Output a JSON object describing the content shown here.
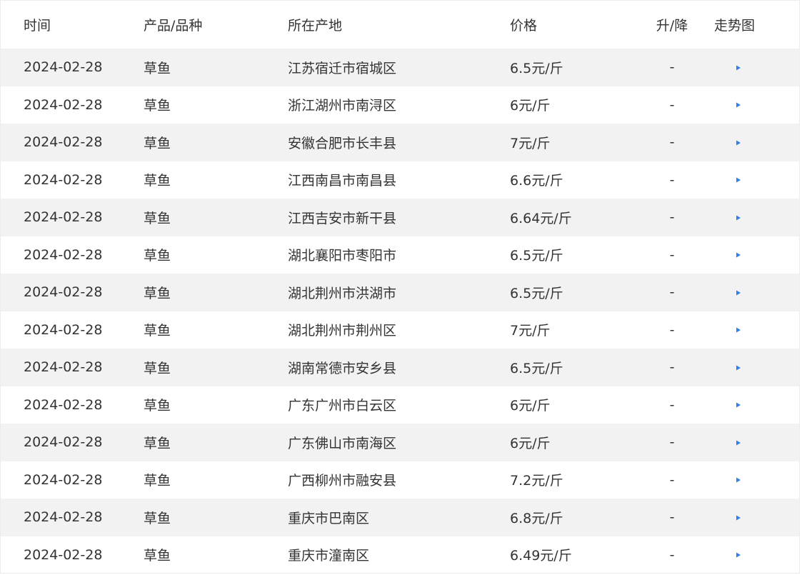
{
  "header": {
    "date": "时间",
    "product": "产品/品种",
    "place": "所在产地",
    "price": "价格",
    "change": "升/降",
    "trend": "走势图"
  },
  "rows": [
    {
      "date": "2024-02-28",
      "product": "草鱼",
      "place": "江苏宿迁市宿城区",
      "price": "6.5元/斤",
      "change": "-"
    },
    {
      "date": "2024-02-28",
      "product": "草鱼",
      "place": "浙江湖州市南浔区",
      "price": "6元/斤",
      "change": "-"
    },
    {
      "date": "2024-02-28",
      "product": "草鱼",
      "place": "安徽合肥市长丰县",
      "price": "7元/斤",
      "change": "-"
    },
    {
      "date": "2024-02-28",
      "product": "草鱼",
      "place": "江西南昌市南昌县",
      "price": "6.6元/斤",
      "change": "-"
    },
    {
      "date": "2024-02-28",
      "product": "草鱼",
      "place": "江西吉安市新干县",
      "price": "6.64元/斤",
      "change": "-"
    },
    {
      "date": "2024-02-28",
      "product": "草鱼",
      "place": "湖北襄阳市枣阳市",
      "price": "6.5元/斤",
      "change": "-"
    },
    {
      "date": "2024-02-28",
      "product": "草鱼",
      "place": "湖北荆州市洪湖市",
      "price": "6.5元/斤",
      "change": "-"
    },
    {
      "date": "2024-02-28",
      "product": "草鱼",
      "place": "湖北荆州市荆州区",
      "price": "7元/斤",
      "change": "-"
    },
    {
      "date": "2024-02-28",
      "product": "草鱼",
      "place": "湖南常德市安乡县",
      "price": "6.5元/斤",
      "change": "-"
    },
    {
      "date": "2024-02-28",
      "product": "草鱼",
      "place": "广东广州市白云区",
      "price": "6元/斤",
      "change": "-"
    },
    {
      "date": "2024-02-28",
      "product": "草鱼",
      "place": "广东佛山市南海区",
      "price": "6元/斤",
      "change": "-"
    },
    {
      "date": "2024-02-28",
      "product": "草鱼",
      "place": "广西柳州市融安县",
      "price": "7.2元/斤",
      "change": "-"
    },
    {
      "date": "2024-02-28",
      "product": "草鱼",
      "place": "重庆市巴南区",
      "price": "6.8元/斤",
      "change": "-"
    },
    {
      "date": "2024-02-28",
      "product": "草鱼",
      "place": "重庆市潼南区",
      "price": "6.49元/斤",
      "change": "-"
    }
  ],
  "trend_icon": "arrow-right-icon",
  "colors": {
    "alt_row": "#f2f2f2",
    "arrow": "#2d7ff0",
    "text": "#333333"
  }
}
